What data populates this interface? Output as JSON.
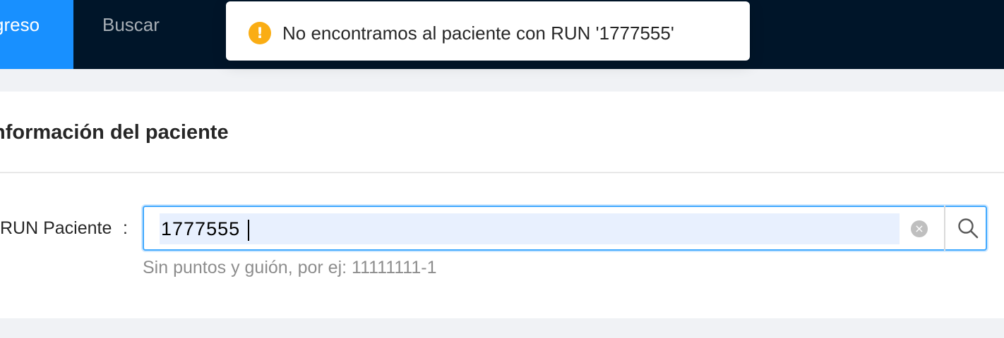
{
  "colors": {
    "nav_background": "#001529",
    "nav_active": "#1890ff",
    "warning": "#faad14",
    "input_focus_border": "#40a9ff",
    "input_fill": "#e8f0fe"
  },
  "nav": {
    "items": [
      {
        "label": "greso",
        "active": true
      },
      {
        "label": "Buscar",
        "active": false
      }
    ]
  },
  "notification": {
    "type": "warning",
    "icon": "exclamation-circle-icon",
    "icon_glyph": "!",
    "message": "No encontramos al paciente con RUN '1777555'"
  },
  "patient_card": {
    "title": "nformación del paciente",
    "run_field": {
      "label": "RUN Paciente",
      "colon": ":",
      "value": "1777555",
      "clear_icon": "close-circle-icon",
      "clear_glyph": "×",
      "search_icon": "search-icon",
      "hint": "Sin puntos y guión, por ej: 11111111-1"
    }
  }
}
